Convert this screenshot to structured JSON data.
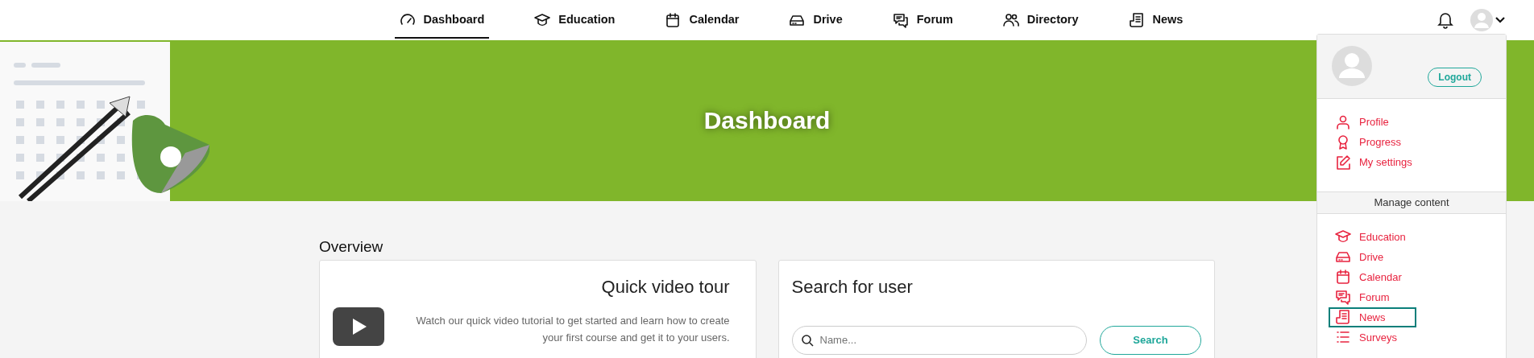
{
  "nav": [
    {
      "label": "Dashboard",
      "selected": true
    },
    {
      "label": "Education",
      "selected": false
    },
    {
      "label": "Calendar",
      "selected": false
    },
    {
      "label": "Drive",
      "selected": false
    },
    {
      "label": "Forum",
      "selected": false
    },
    {
      "label": "Directory",
      "selected": false
    },
    {
      "label": "News",
      "selected": false
    }
  ],
  "banner": {
    "title": "Dashboard"
  },
  "user_menu": {
    "logout": "Logout",
    "items": [
      {
        "label": "Profile"
      },
      {
        "label": "Progress"
      },
      {
        "label": "My settings"
      }
    ],
    "section_title": "Manage content",
    "manage_items": [
      {
        "label": "Education",
        "highlighted": false
      },
      {
        "label": "Drive",
        "highlighted": false
      },
      {
        "label": "Calendar",
        "highlighted": false
      },
      {
        "label": "Forum",
        "highlighted": false
      },
      {
        "label": "News",
        "highlighted": true
      },
      {
        "label": "Surveys",
        "highlighted": false
      }
    ]
  },
  "overview": {
    "title": "Overview",
    "video_card": {
      "title": "Quick video tour",
      "text": "Watch our quick video tutorial to get started and learn how to create your first course and get it to your users."
    },
    "search_card": {
      "title": "Search for user",
      "placeholder": "Name...",
      "button": "Search"
    }
  }
}
